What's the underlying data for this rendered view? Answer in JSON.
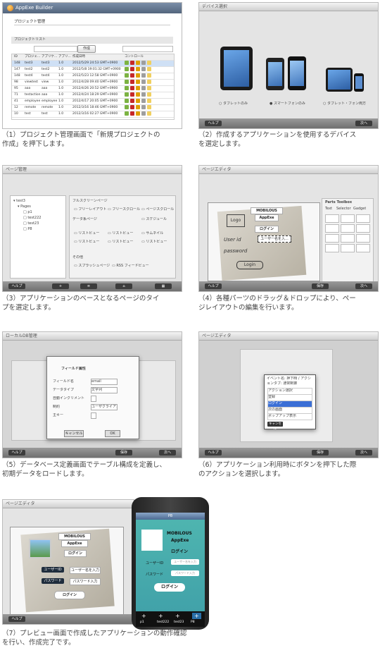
{
  "captions": [
    "（1）プロジェクト管理画面で「新規プロジェクトの",
    "作成」を押下します。",
    "（2）作成するアプリケーションを使用するデバイス",
    "を選定します。",
    "（3）アプリケーションのベースとなるページのタイ",
    "プを選定します。",
    "（4）各種パーツのドラッグ＆ドロップにより、ペー",
    "ジレイアウトの編集を行います。",
    "（5）データベース定義画面でテーブル構成を定義し、",
    "初期データをロードします。",
    "（6）アプリケーション利用時にボタンを押下した際",
    "のアクションを選択します。",
    "（7）プレビュー画面で作成したアプリケーションの動作確認",
    "を行い、作成完了です。"
  ],
  "s1": {
    "app_title": "AppExe Builder",
    "section": "プロジェクト管理",
    "list_label": "プロジェクトリスト",
    "new_button": "作成",
    "headers": [
      "ID",
      "プロジェ...",
      "アプリケ...",
      "アプリ...",
      "作成日時",
      "コントロール"
    ],
    "rows": [
      [
        "148",
        "test3",
        "test3",
        "1.0",
        "2012/5/29 24:53 GMT+0900"
      ],
      [
        "147",
        "test2",
        "test2",
        "1.0",
        "2012/5/8 19:01:32 GMT+0900"
      ],
      [
        "148",
        "test4",
        "test4",
        "1.0",
        "2012/5/23 12:58 GMT+0900"
      ],
      [
        "98",
        "viewtest",
        "view",
        "1.0",
        "2012/4/28 09:40 GMT+0900"
      ],
      [
        "95",
        "aaa",
        "aaa",
        "1.0",
        "2012/4/26 20:52 GMT+0900"
      ],
      [
        "71",
        "testaction",
        "aaa",
        "1.0",
        "2012/4/24 18:29 GMT+0900"
      ],
      [
        "41",
        "employee",
        "employee",
        "1.0",
        "2012/4/17 20:05 GMT+0900"
      ],
      [
        "12",
        "remote",
        "remote",
        "1.0",
        "2012/3/16 18:46 GMT+0900"
      ],
      [
        "10",
        "test",
        "test",
        "1.0",
        "2012/3/16 02:27 GMT+0900"
      ]
    ]
  },
  "s2": {
    "title": "デバイス選択",
    "opt_tablet": "タブレットのみ",
    "opt_phone": "スマートフォンのみ",
    "opt_both": "タブレット・フォン両方",
    "help": "ヘルプ",
    "next": "次へ"
  },
  "s3": {
    "title": "ページ管理",
    "tree": [
      "test3",
      "Pages",
      "p1",
      "test222",
      "test23",
      "P8"
    ],
    "groups": [
      "フルスクリーンページ",
      "データ系ページ",
      "その他"
    ],
    "items": [
      "フリーレイアウト",
      "フリースクロール",
      "ページスクロール",
      "スケジュール",
      "リストビュー",
      "サムネイル",
      "スプラッシュページ",
      "RSS フィードビュー"
    ],
    "help": "ヘルプ"
  },
  "s4": {
    "title": "ページエディタ",
    "palette": "Parts Toolbox",
    "palette_tabs": [
      "Text",
      "Selector",
      "Gadget"
    ],
    "canvas": {
      "brand": "MOBILOUS",
      "app": "AppExe",
      "login_btn": "ログイン",
      "logo": "Logo",
      "user_label": "User id",
      "user_field": "ユーザー名を入...",
      "pass_label": "password",
      "login_sketch": "Login"
    },
    "help": "ヘルプ",
    "save": "保存",
    "next": "次へ"
  },
  "s5": {
    "title": "ローカルDB管理",
    "dialog_title": "フィールド属性",
    "fields": [
      "フィールド名",
      "データタイプ",
      "自動インクリメント",
      "制約",
      "主キー"
    ],
    "values": [
      "email",
      "文字列",
      "",
      "ユーザクライアント",
      ""
    ],
    "ok": "OK",
    "cancel": "キャンセル",
    "help": "ヘルプ",
    "save": "保存",
    "next": "次へ"
  },
  "s6": {
    "title": "ページエディタ",
    "dialog_title": "イベント名: 押下時 / アクションタブ: 通常制御",
    "options": [
      "アクション選択",
      "登録",
      "ログイン",
      "次の画面",
      "ポップアップ表示"
    ],
    "selected": 2,
    "cancel": "キャンセル",
    "help": "ヘルプ",
    "save": "保存",
    "next": "次へ"
  },
  "s7": {
    "title": "ページエディタ",
    "phone_title": "P8",
    "brand": "MOBILOUS",
    "app": "AppExe",
    "login_label": "ログイン",
    "user_label": "ユーザーID",
    "user_field": "ユーザー名を入力",
    "pass_label": "パスワード",
    "pass_field": "パスワード入力",
    "login_button": "ログイン",
    "tabs": [
      "p1",
      "test222",
      "test23",
      "P8"
    ],
    "help": "ヘルプ"
  }
}
